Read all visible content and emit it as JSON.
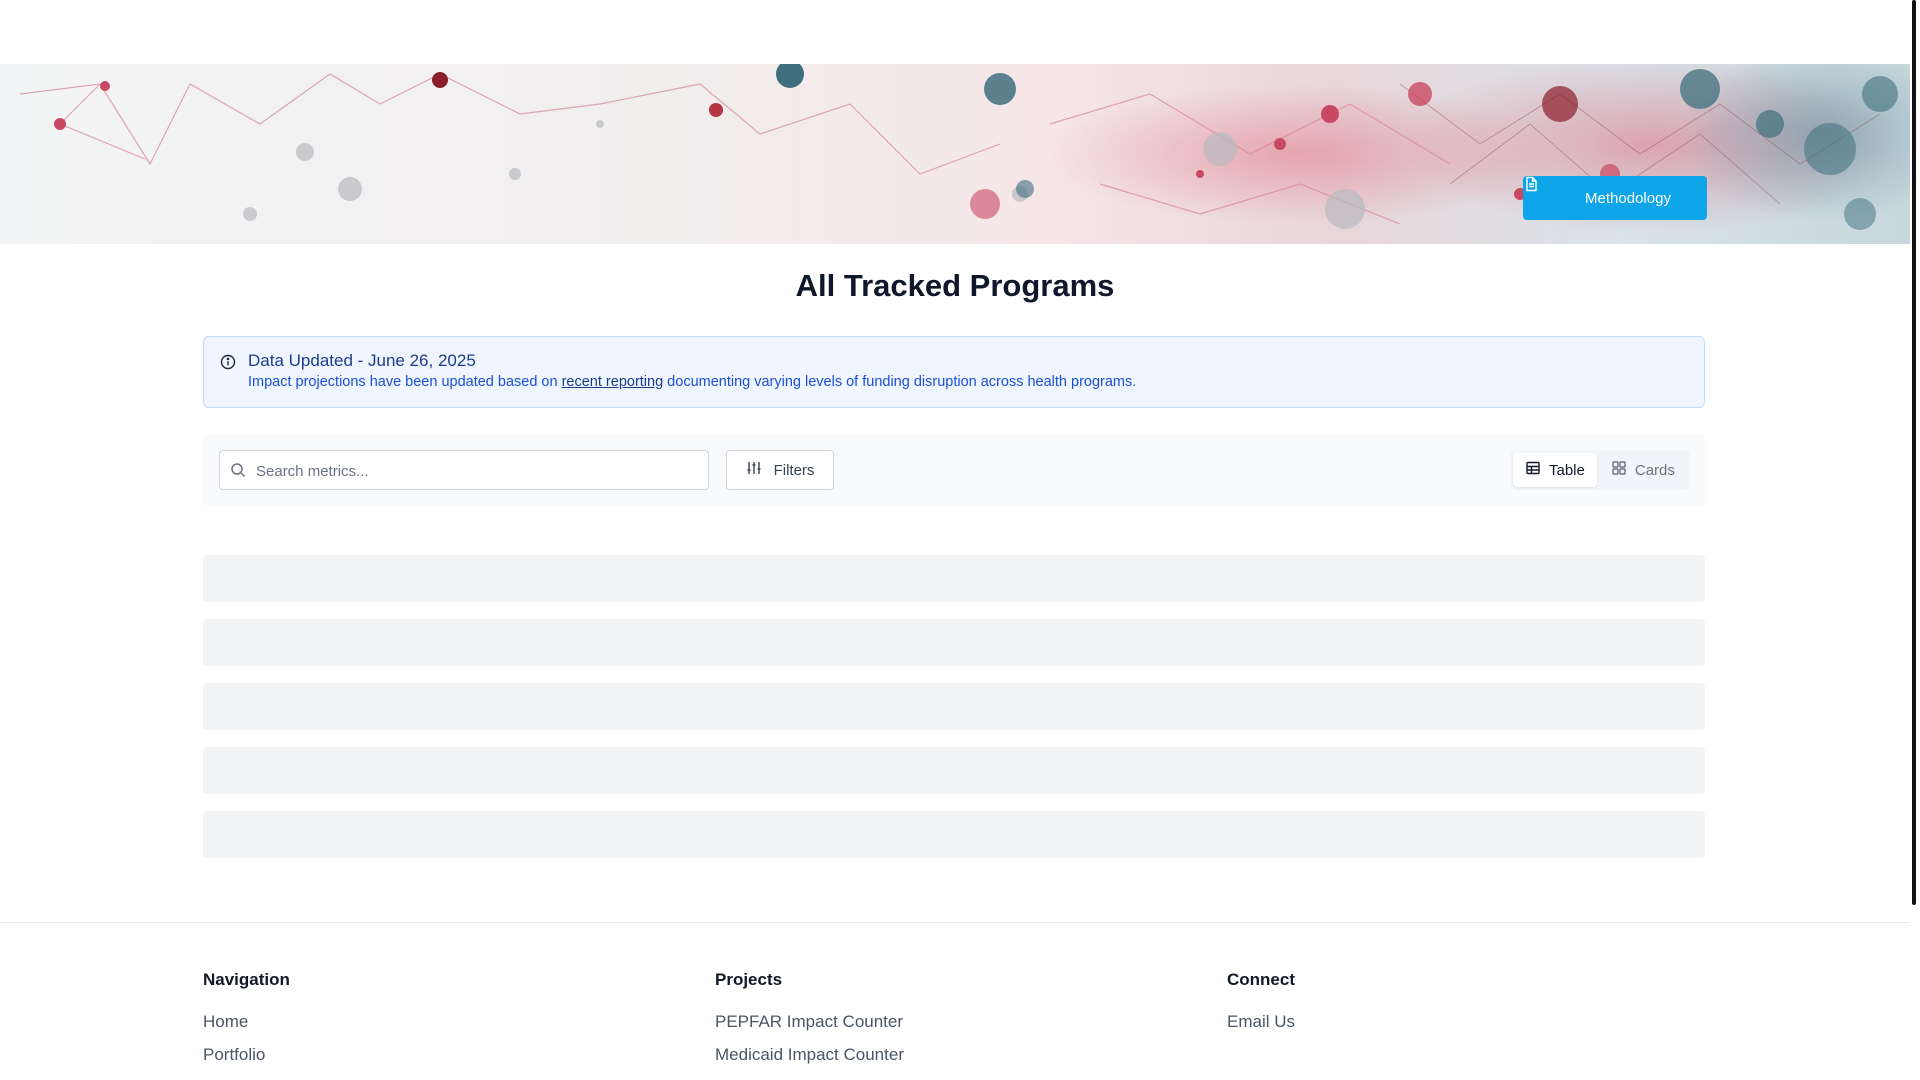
{
  "hero": {
    "methodology_label": "Methodology",
    "accent_color": "#0ea5e9"
  },
  "page": {
    "title": "All Tracked Programs"
  },
  "notice": {
    "title": "Data Updated - June 26, 2025",
    "body_before": "Impact projections have been updated based on ",
    "link_text": "recent reporting",
    "body_after": " documenting varying levels of funding disruption across health programs.",
    "icon": "info-icon"
  },
  "toolbar": {
    "search_placeholder": "Search metrics...",
    "search_value": "",
    "filters_label": "Filters",
    "view_options": [
      {
        "label": "Table",
        "icon": "table-icon",
        "active": true
      },
      {
        "label": "Cards",
        "icon": "grid-icon",
        "active": false
      }
    ]
  },
  "footer": {
    "columns": [
      {
        "heading": "Navigation",
        "links": [
          "Home",
          "Portfolio"
        ]
      },
      {
        "heading": "Projects",
        "links": [
          "PEPFAR Impact Counter",
          "Medicaid Impact Counter"
        ]
      },
      {
        "heading": "Connect",
        "links": [
          "Email Us"
        ]
      }
    ]
  }
}
